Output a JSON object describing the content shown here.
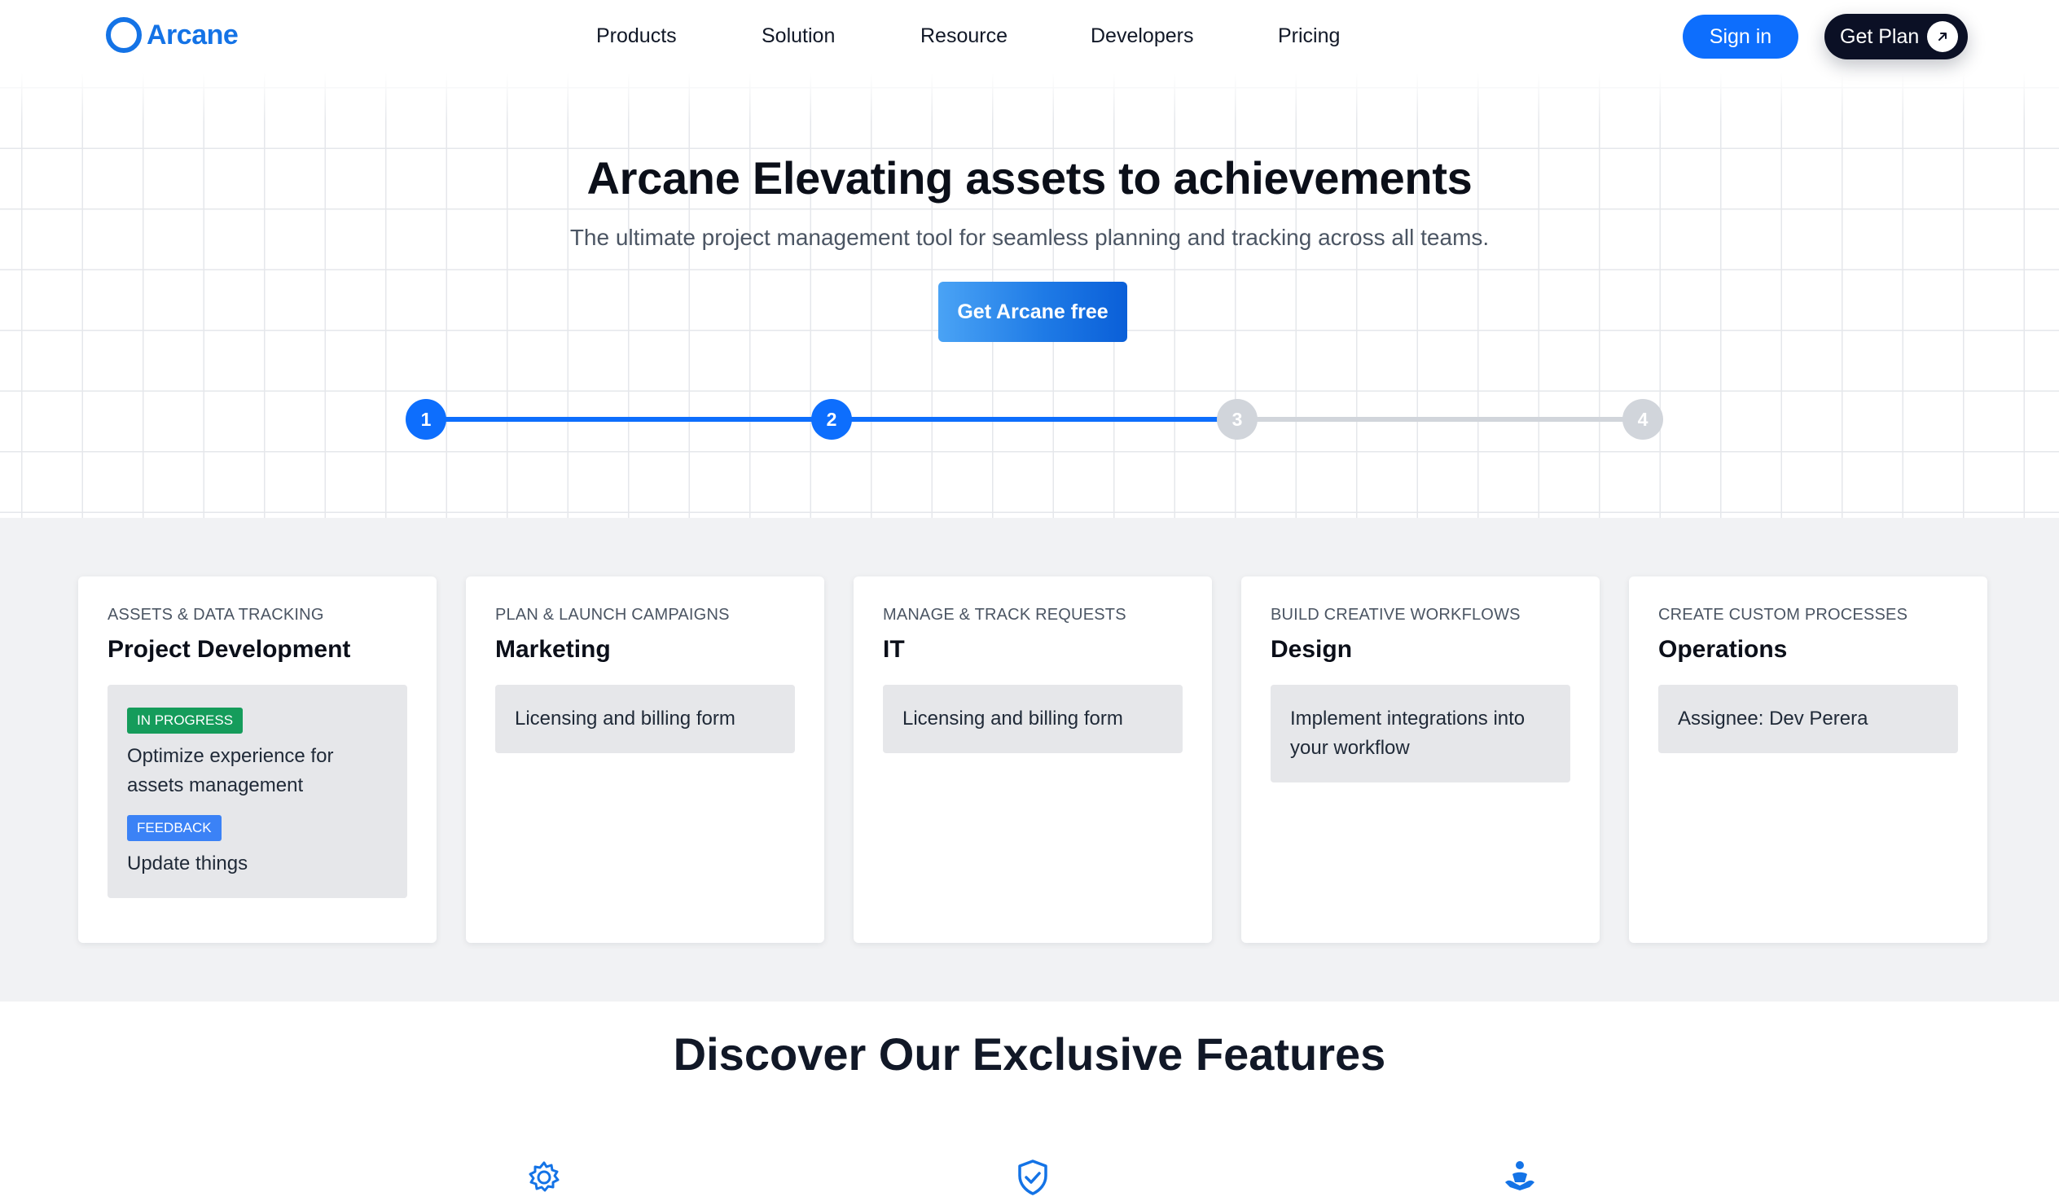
{
  "header": {
    "brand": "Arcane",
    "nav": [
      "Products",
      "Solution",
      "Resource",
      "Developers",
      "Pricing"
    ],
    "sign_in": "Sign in",
    "get_plan": "Get Plan",
    "get_plan_icon": "arrow-up-right-icon"
  },
  "hero": {
    "title": "Arcane Elevating assets to achievements",
    "subtitle": "The ultimate project management tool for seamless planning and tracking across all teams.",
    "cta": "Get Arcane free",
    "steps": [
      {
        "label": "1",
        "state": "active"
      },
      {
        "label": "2",
        "state": "active"
      },
      {
        "label": "3",
        "state": "inactive"
      },
      {
        "label": "4",
        "state": "inactive"
      }
    ],
    "colors": {
      "active": "#0d6efd",
      "inactive": "#d1d5db"
    }
  },
  "cards": [
    {
      "kicker": "ASSETS & DATA TRACKING",
      "title": "Project Development",
      "tasks": [
        {
          "badge": "IN PROGRESS",
          "badge_color": "#159c5b",
          "text": "Optimize experience for assets management"
        },
        {
          "badge": "FEEDBACK",
          "badge_color": "#3b82f6",
          "text": "Update things"
        }
      ]
    },
    {
      "kicker": "PLAN & LAUNCH CAMPAIGNS",
      "title": "Marketing",
      "tasks": [
        {
          "text": "Licensing and billing form"
        }
      ]
    },
    {
      "kicker": "MANAGE & TRACK REQUESTS",
      "title": "IT",
      "tasks": [
        {
          "text": "Licensing and billing form"
        }
      ]
    },
    {
      "kicker": "BUILD CREATIVE WORKFLOWS",
      "title": "Design",
      "tasks": [
        {
          "text": "Implement integrations into your workflow"
        }
      ]
    },
    {
      "kicker": "CREATE CUSTOM PROCESSES",
      "title": "Operations",
      "tasks": [
        {
          "text": "Assignee: Dev Perera"
        }
      ]
    }
  ],
  "features": {
    "title": "Discover Our Exclusive Features",
    "icons": [
      "gear-icon",
      "shield-check-icon",
      "meditation-person-icon"
    ],
    "accent": "#1473e6"
  }
}
